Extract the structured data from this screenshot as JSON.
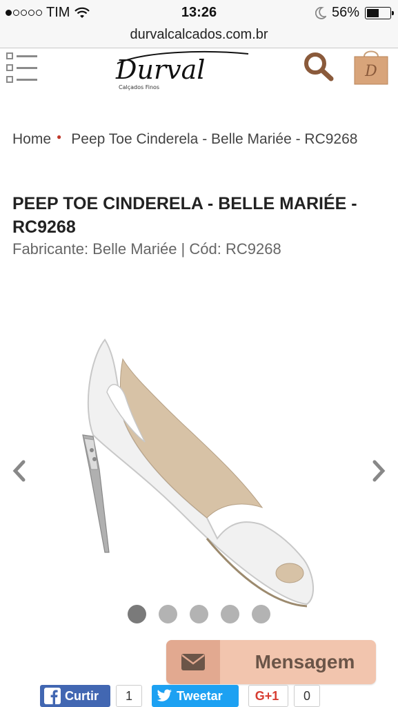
{
  "status_bar": {
    "carrier": "TIM",
    "time": "13:26",
    "battery": "56%",
    "battery_level": 0.56,
    "signal_bars": 1
  },
  "browser": {
    "url": "durvalcalcados.com.br"
  },
  "header": {
    "logo_text": "Durval",
    "logo_subtitle": "Calçados Finos",
    "bag_logo_letter": "D"
  },
  "breadcrumb": {
    "home": "Home",
    "current": "Peep Toe Cinderela - Belle Mariée - RC9268"
  },
  "product": {
    "title": "PEEP TOE CINDERELA - BELLE MARIÉE - RC9268",
    "meta": "Fabricante: Belle Mariée | Cód: RC9268"
  },
  "gallery": {
    "prev_label": "‹",
    "next_label": "›",
    "slide_count": 5,
    "active_index": 0
  },
  "message_button": {
    "label": "Mensagem"
  },
  "social": {
    "facebook_label": "Curtir",
    "facebook_count": "1",
    "twitter_label": "Tweetar",
    "google_label": "G+1",
    "google_count": "0"
  },
  "colors": {
    "accent_brown": "#8a5a3b",
    "message_bg": "#f2c5ae",
    "facebook": "#4267b2",
    "twitter": "#1da1f2"
  }
}
